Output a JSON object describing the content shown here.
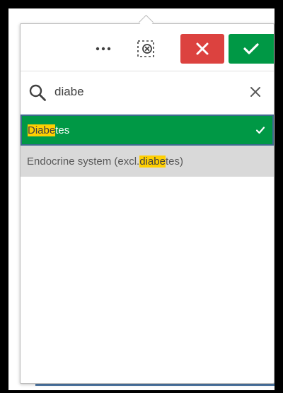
{
  "toolbar": {
    "more_label": "•••",
    "more_icon": "more-horizontal-icon",
    "clear_selections_icon": "clear-selections-icon",
    "cancel_icon": "close-icon",
    "confirm_icon": "checkmark-icon",
    "cancel_color": "#dc423f",
    "confirm_color": "#009845"
  },
  "search": {
    "icon": "search-icon",
    "value": "diabe",
    "clear_icon": "close-icon"
  },
  "list": {
    "items": [
      {
        "highlight": "Diabe",
        "rest": "tes",
        "state": "selected",
        "selected_color": "#009845"
      },
      {
        "prefix": "Endocrine system (excl. ",
        "highlight": "diabe",
        "rest": "tes)",
        "state": "alternative",
        "alt_color": "#d9d9d9"
      }
    ],
    "highlight_color": "#ffcf02"
  }
}
